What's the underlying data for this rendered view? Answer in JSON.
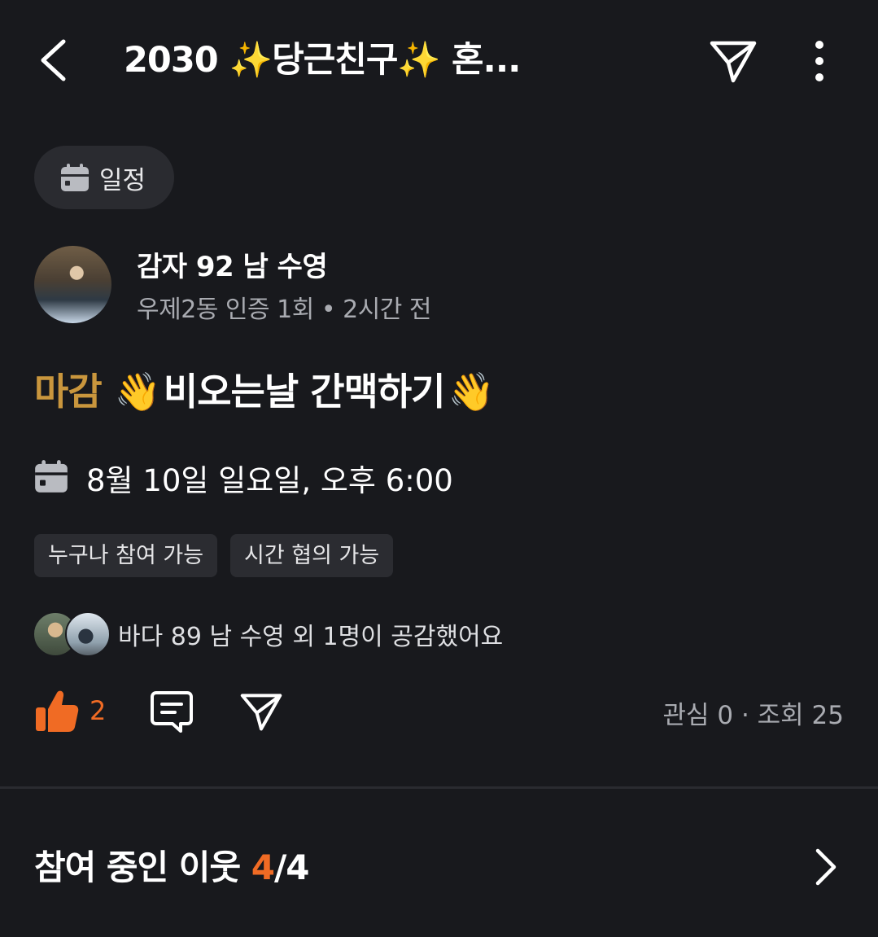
{
  "header": {
    "title": "2030 ✨당근친구✨ 혼..."
  },
  "category": {
    "label": "일정",
    "icon": "calendar-icon"
  },
  "author": {
    "name": "감자 92 남 수영",
    "meta": "우제2동 인증 1회 • 2시간 전"
  },
  "post": {
    "status_badge": "마감",
    "wave_emoji": "👋",
    "title": "비오는날 간맥하기",
    "date": "8월 10일 일요일, 오후 6:00",
    "tags": [
      "누구나 참여 가능",
      "시간 협의 가능"
    ]
  },
  "reactions": {
    "likers_text": "바다 89 남 수영 외 1명이 공감했어요",
    "like_count": "2",
    "stats": "관심 0 · 조회 25"
  },
  "participants": {
    "label": "참여 중인 이웃",
    "current": "4",
    "separator": "/",
    "max": "4"
  },
  "colors": {
    "background": "#18191d",
    "accent_orange": "#f06b24",
    "closed_badge": "#c9963d",
    "chip_bg": "#2a2b30"
  }
}
